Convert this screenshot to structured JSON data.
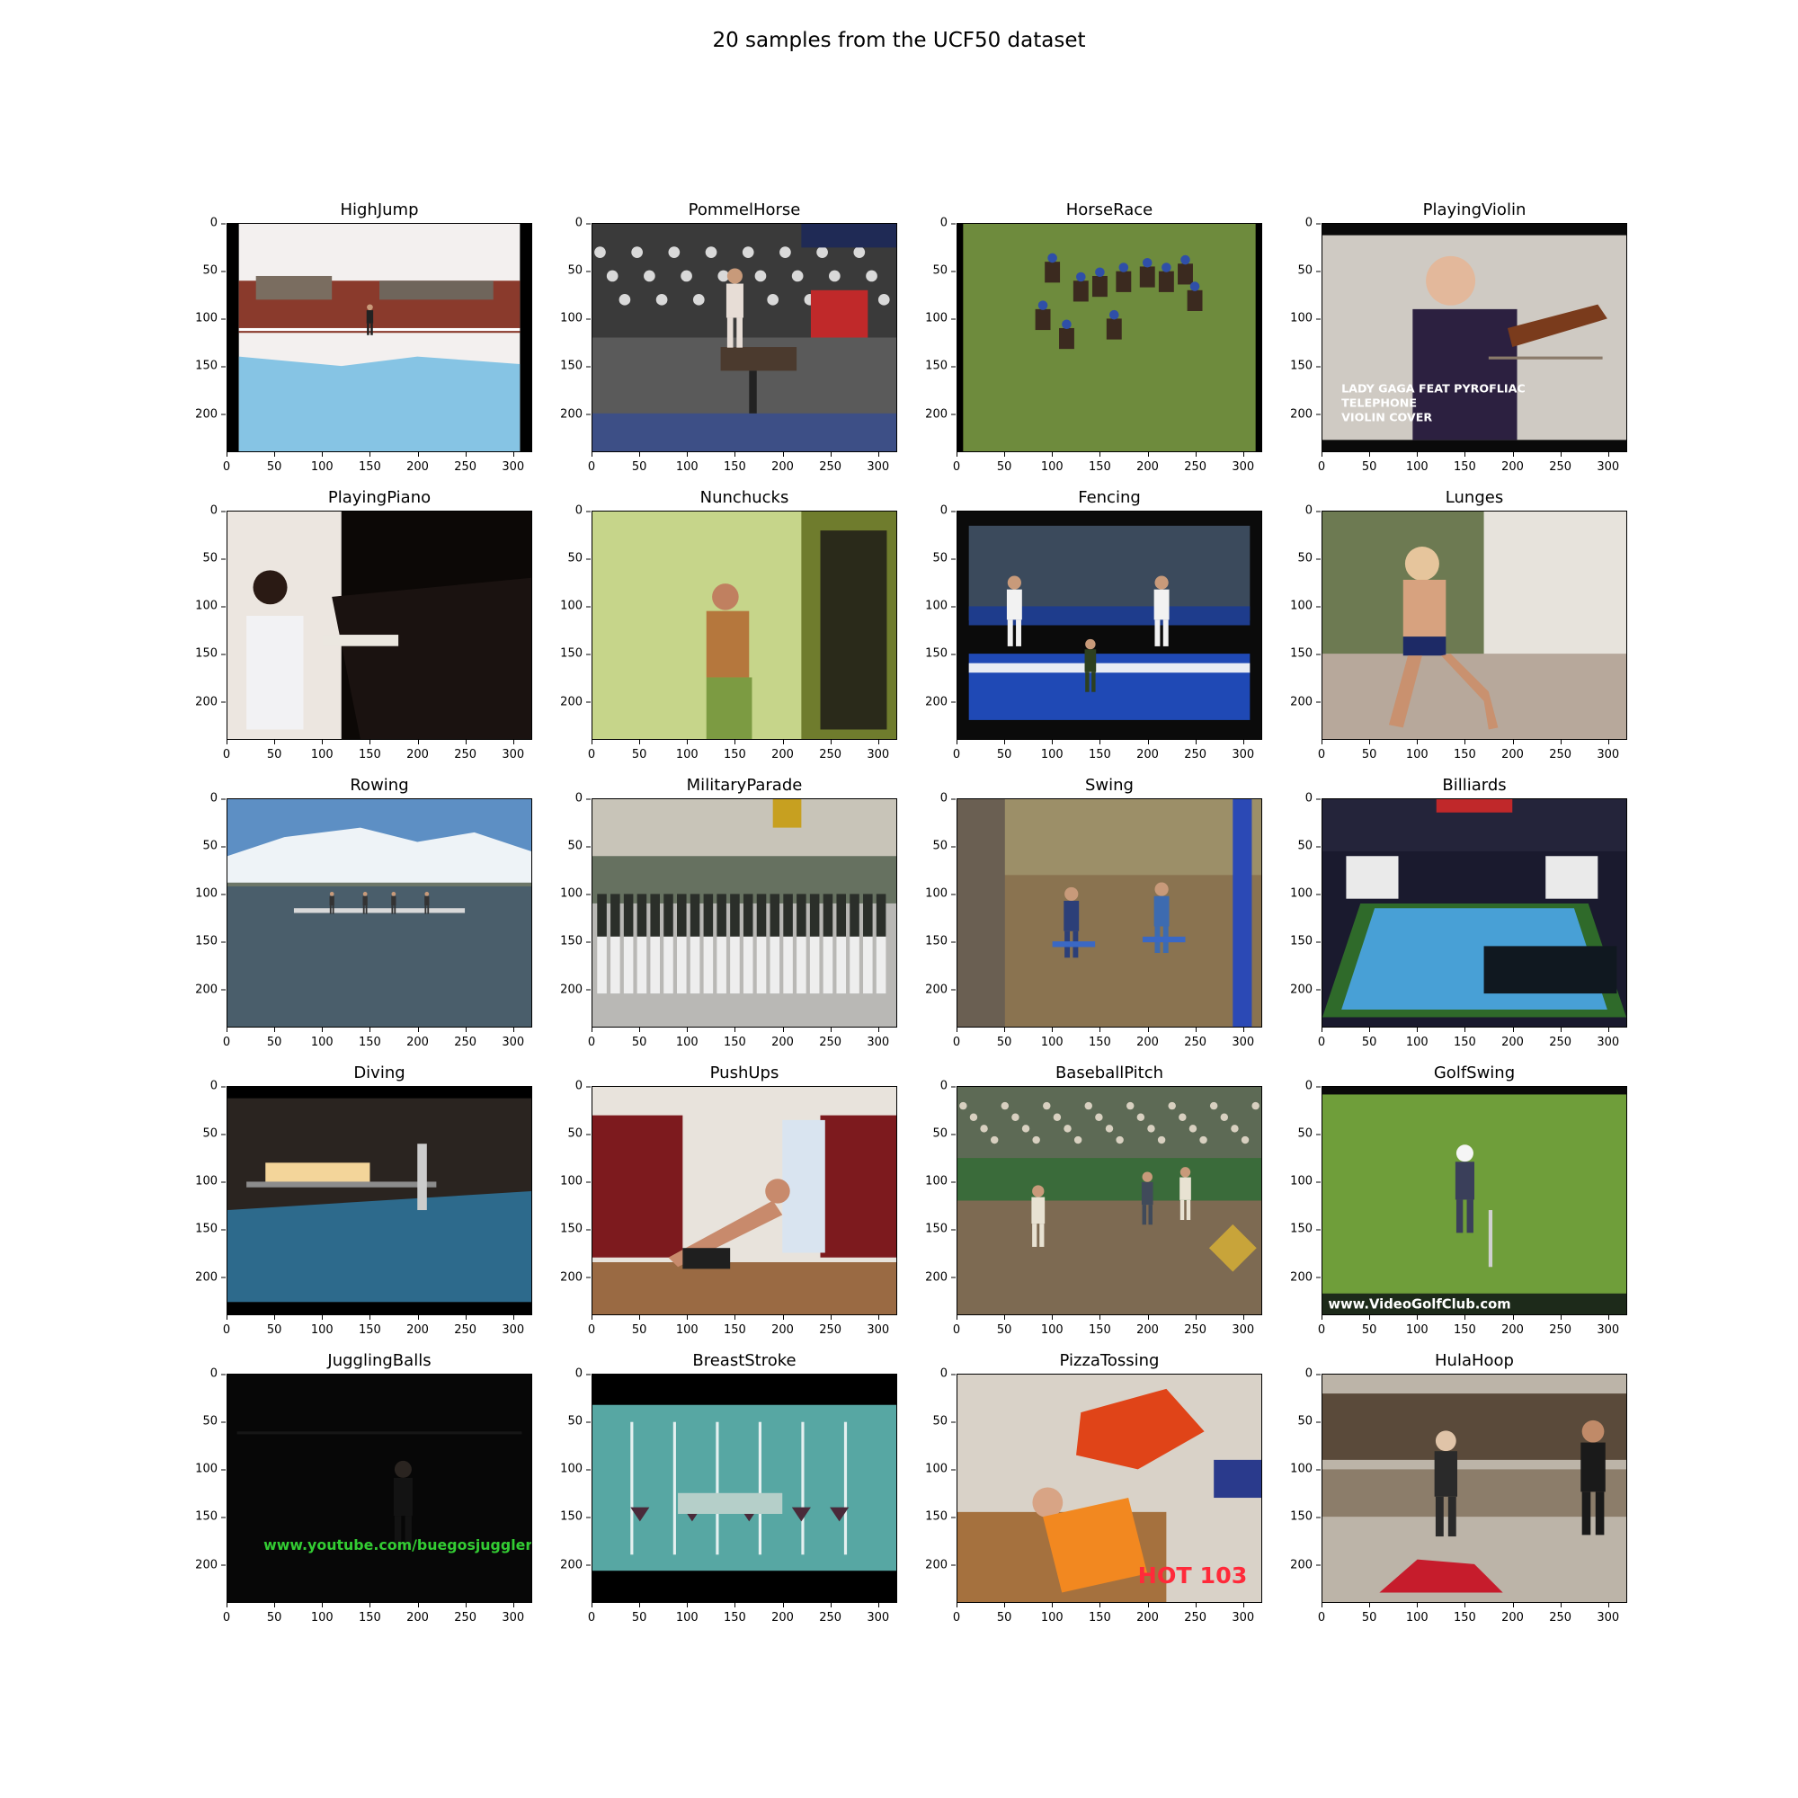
{
  "title": "20 samples from the UCF50 dataset",
  "x_ticks": [
    "0",
    "50",
    "100",
    "150",
    "200",
    "250",
    "300"
  ],
  "y_ticks": [
    "0",
    "50",
    "100",
    "150",
    "200"
  ],
  "panels": [
    {
      "label": "HighJump",
      "scene": "high-jump-track-mat"
    },
    {
      "label": "PommelHorse",
      "scene": "gymnast-pommel-horse-crowd"
    },
    {
      "label": "HorseRace",
      "scene": "horses-racing-on-grass"
    },
    {
      "label": "PlayingViolin",
      "scene": "man-playing-violin",
      "overlay": [
        "LADY GAGA FEAT PYROFLIAC",
        "TELEPHONE",
        "VIOLIN COVER"
      ]
    },
    {
      "label": "PlayingPiano",
      "scene": "woman-at-grand-piano"
    },
    {
      "label": "Nunchucks",
      "scene": "person-in-green-room"
    },
    {
      "label": "Fencing",
      "scene": "fencers-on-blue-piste"
    },
    {
      "label": "Lunges",
      "scene": "man-doing-lunge-outdoors"
    },
    {
      "label": "Rowing",
      "scene": "rowing-boat-on-lake"
    },
    {
      "label": "MilitaryParade",
      "scene": "marching-soldiers"
    },
    {
      "label": "Swing",
      "scene": "children-on-swings"
    },
    {
      "label": "Billiards",
      "scene": "pool-table-broadcast"
    },
    {
      "label": "Diving",
      "scene": "diving-pool-indoor"
    },
    {
      "label": "PushUps",
      "scene": "man-doing-pushups"
    },
    {
      "label": "BaseballPitch",
      "scene": "baseball-field-broadcast"
    },
    {
      "label": "GolfSwing",
      "scene": "golfer-on-fairway",
      "overlay": [
        "www.VideoGolfClub.com"
      ]
    },
    {
      "label": "JugglingBalls",
      "scene": "dark-stage-juggler",
      "overlay": [
        "www.youtube.com/buegosjuggler"
      ]
    },
    {
      "label": "BreastStroke",
      "scene": "swimmer-underwater-pool"
    },
    {
      "label": "PizzaTossing",
      "scene": "man-in-pizza-shop",
      "overlay": [
        "HOT 103"
      ]
    },
    {
      "label": "HulaHoop",
      "scene": "classroom-hula-hoop"
    }
  ]
}
